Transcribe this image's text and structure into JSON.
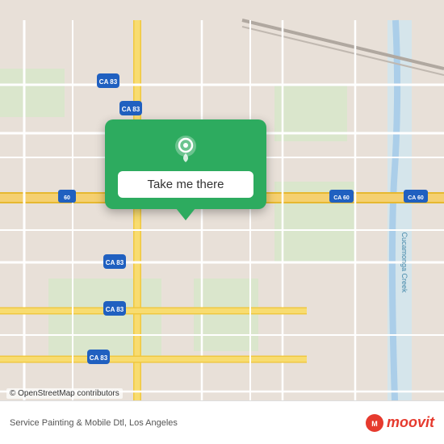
{
  "map": {
    "background_color": "#e8e0d8",
    "road_color": "#ffffff",
    "highway_color": "#f5d070",
    "highway_outline_color": "#e6b830",
    "route_color": "#3f8f3f",
    "water_color": "#b0d8f0",
    "park_color": "#c8e6c0",
    "grid_color": "#d0c8be"
  },
  "popup": {
    "background": "#2dab5f",
    "button_label": "Take me there",
    "button_bg": "#ffffff",
    "button_text_color": "#333333"
  },
  "attribution": {
    "osm_text": "© OpenStreetMap contributors",
    "bottom_text": "Service Painting & Mobile Dtl, Los Angeles"
  },
  "moovit": {
    "logo_text": "moovit"
  },
  "labels": {
    "ca83_1": "CA 83",
    "ca83_2": "CA 83",
    "ca83_3": "CA 83",
    "ca83_4": "CA 83",
    "ca60_left": "60",
    "ca60_mid": "CA 60",
    "ca60_right": "CA 60",
    "cucanonga": "Cucamonga\nCreek"
  }
}
